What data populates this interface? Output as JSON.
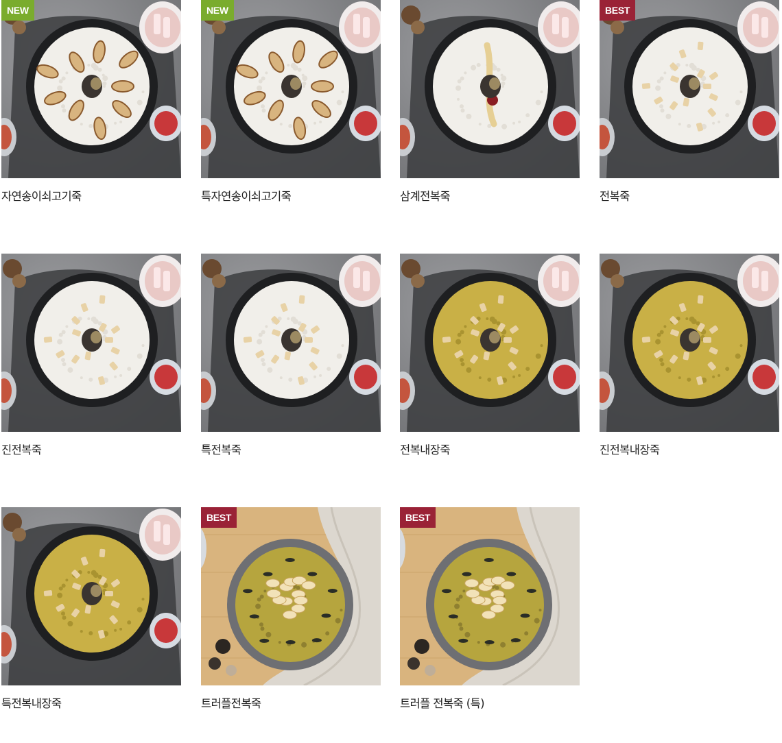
{
  "products": [
    {
      "name": "자연송이쇠고기죽",
      "badge": "NEW",
      "badge_type": "new",
      "style": "grey",
      "porridge": "white",
      "topping": "mushroom"
    },
    {
      "name": "특자연송이쇠고기죽",
      "badge": "NEW",
      "badge_type": "new",
      "style": "grey",
      "porridge": "white",
      "topping": "mushroom"
    },
    {
      "name": "삼계전복죽",
      "badge": "",
      "badge_type": "",
      "style": "grey",
      "porridge": "white",
      "topping": "ginseng"
    },
    {
      "name": "전복죽",
      "badge": "BEST",
      "badge_type": "best",
      "style": "grey",
      "porridge": "white",
      "topping": "abalone"
    },
    {
      "name": "진전복죽",
      "badge": "",
      "badge_type": "",
      "style": "grey",
      "porridge": "white",
      "topping": "abalone"
    },
    {
      "name": "특전복죽",
      "badge": "",
      "badge_type": "",
      "style": "grey",
      "porridge": "white",
      "topping": "abalone"
    },
    {
      "name": "전복내장죽",
      "badge": "",
      "badge_type": "",
      "style": "grey",
      "porridge": "yellow",
      "topping": "abalone"
    },
    {
      "name": "진전복내장죽",
      "badge": "",
      "badge_type": "",
      "style": "grey",
      "porridge": "yellow",
      "topping": "abalone"
    },
    {
      "name": "특전복내장죽",
      "badge": "",
      "badge_type": "",
      "style": "grey",
      "porridge": "yellow",
      "topping": "abalone"
    },
    {
      "name": "트러플전복죽",
      "badge": "BEST",
      "badge_type": "best",
      "style": "wood",
      "porridge": "green",
      "topping": "truffle"
    },
    {
      "name": "트러플 전복죽 (특)",
      "badge": "BEST",
      "badge_type": "best",
      "style": "wood",
      "porridge": "green",
      "topping": "truffle"
    }
  ],
  "colors": {
    "badge_new": "#7aac2d",
    "badge_best": "#9a2236",
    "text": "#222222"
  }
}
